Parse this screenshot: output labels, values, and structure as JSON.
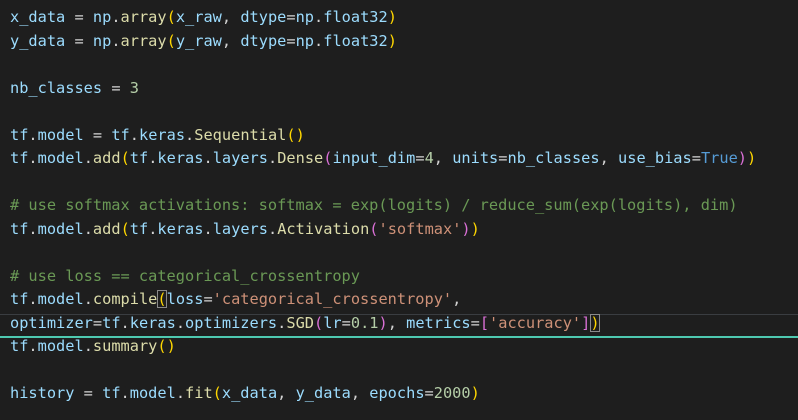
{
  "editor": {
    "theme_colors": {
      "background": "#1e1e1e",
      "variable": "#9cdcfe",
      "function": "#dcdcaa",
      "number": "#b5cea8",
      "string": "#ce9178",
      "comment": "#6a9955",
      "keyword": "#569cd6",
      "bracket_1": "#ffd700",
      "bracket_2": "#da70d6",
      "bracket_3": "#179fff",
      "active_line_underline": "#4ec9b0"
    },
    "lines": [
      {
        "tokens": [
          {
            "t": "x_data",
            "c": "t-var"
          },
          {
            "t": " = ",
            "c": "t-op"
          },
          {
            "t": "np",
            "c": "t-var"
          },
          {
            "t": ".",
            "c": "t-op"
          },
          {
            "t": "array",
            "c": "t-fn"
          },
          {
            "t": "(",
            "c": "t-b1"
          },
          {
            "t": "x_raw",
            "c": "t-var"
          },
          {
            "t": ", ",
            "c": "t-op"
          },
          {
            "t": "dtype",
            "c": "t-var"
          },
          {
            "t": "=",
            "c": "t-op"
          },
          {
            "t": "np",
            "c": "t-var"
          },
          {
            "t": ".",
            "c": "t-op"
          },
          {
            "t": "float32",
            "c": "t-var"
          },
          {
            "t": ")",
            "c": "t-b1"
          }
        ]
      },
      {
        "tokens": [
          {
            "t": "y_data",
            "c": "t-var"
          },
          {
            "t": " = ",
            "c": "t-op"
          },
          {
            "t": "np",
            "c": "t-var"
          },
          {
            "t": ".",
            "c": "t-op"
          },
          {
            "t": "array",
            "c": "t-fn"
          },
          {
            "t": "(",
            "c": "t-b1"
          },
          {
            "t": "y_raw",
            "c": "t-var"
          },
          {
            "t": ", ",
            "c": "t-op"
          },
          {
            "t": "dtype",
            "c": "t-var"
          },
          {
            "t": "=",
            "c": "t-op"
          },
          {
            "t": "np",
            "c": "t-var"
          },
          {
            "t": ".",
            "c": "t-op"
          },
          {
            "t": "float32",
            "c": "t-var"
          },
          {
            "t": ")",
            "c": "t-b1"
          }
        ]
      },
      {
        "tokens": []
      },
      {
        "tokens": [
          {
            "t": "nb_classes",
            "c": "t-var"
          },
          {
            "t": " = ",
            "c": "t-op"
          },
          {
            "t": "3",
            "c": "t-num"
          }
        ]
      },
      {
        "tokens": []
      },
      {
        "tokens": [
          {
            "t": "tf",
            "c": "t-var"
          },
          {
            "t": ".",
            "c": "t-op"
          },
          {
            "t": "model",
            "c": "t-var"
          },
          {
            "t": " = ",
            "c": "t-op"
          },
          {
            "t": "tf",
            "c": "t-var"
          },
          {
            "t": ".",
            "c": "t-op"
          },
          {
            "t": "keras",
            "c": "t-var"
          },
          {
            "t": ".",
            "c": "t-op"
          },
          {
            "t": "Sequential",
            "c": "t-fn"
          },
          {
            "t": "()",
            "c": "t-b1"
          }
        ]
      },
      {
        "tokens": [
          {
            "t": "tf",
            "c": "t-var"
          },
          {
            "t": ".",
            "c": "t-op"
          },
          {
            "t": "model",
            "c": "t-var"
          },
          {
            "t": ".",
            "c": "t-op"
          },
          {
            "t": "add",
            "c": "t-fn"
          },
          {
            "t": "(",
            "c": "t-b1"
          },
          {
            "t": "tf",
            "c": "t-var"
          },
          {
            "t": ".",
            "c": "t-op"
          },
          {
            "t": "keras",
            "c": "t-var"
          },
          {
            "t": ".",
            "c": "t-op"
          },
          {
            "t": "layers",
            "c": "t-var"
          },
          {
            "t": ".",
            "c": "t-op"
          },
          {
            "t": "Dense",
            "c": "t-fn"
          },
          {
            "t": "(",
            "c": "t-b2"
          },
          {
            "t": "input_dim",
            "c": "t-var"
          },
          {
            "t": "=",
            "c": "t-op"
          },
          {
            "t": "4",
            "c": "t-num"
          },
          {
            "t": ", ",
            "c": "t-op"
          },
          {
            "t": "units",
            "c": "t-var"
          },
          {
            "t": "=",
            "c": "t-op"
          },
          {
            "t": "nb_classes",
            "c": "t-var"
          },
          {
            "t": ", ",
            "c": "t-op"
          },
          {
            "t": "use_bias",
            "c": "t-var"
          },
          {
            "t": "=",
            "c": "t-op"
          },
          {
            "t": "True",
            "c": "t-kw"
          },
          {
            "t": ")",
            "c": "t-b2"
          },
          {
            "t": ")",
            "c": "t-b1"
          }
        ]
      },
      {
        "tokens": []
      },
      {
        "tokens": [
          {
            "t": "# use softmax activations: softmax = exp(logits) / reduce_sum(exp(logits), dim)",
            "c": "t-cmt"
          }
        ]
      },
      {
        "tokens": [
          {
            "t": "tf",
            "c": "t-var"
          },
          {
            "t": ".",
            "c": "t-op"
          },
          {
            "t": "model",
            "c": "t-var"
          },
          {
            "t": ".",
            "c": "t-op"
          },
          {
            "t": "add",
            "c": "t-fn"
          },
          {
            "t": "(",
            "c": "t-b1"
          },
          {
            "t": "tf",
            "c": "t-var"
          },
          {
            "t": ".",
            "c": "t-op"
          },
          {
            "t": "keras",
            "c": "t-var"
          },
          {
            "t": ".",
            "c": "t-op"
          },
          {
            "t": "layers",
            "c": "t-var"
          },
          {
            "t": ".",
            "c": "t-op"
          },
          {
            "t": "Activation",
            "c": "t-fn"
          },
          {
            "t": "(",
            "c": "t-b2"
          },
          {
            "t": "'softmax'",
            "c": "t-str"
          },
          {
            "t": ")",
            "c": "t-b2"
          },
          {
            "t": ")",
            "c": "t-b1"
          }
        ]
      },
      {
        "tokens": []
      },
      {
        "tokens": [
          {
            "t": "# use loss == categorical_crossentropy",
            "c": "t-cmt"
          }
        ]
      },
      {
        "tokens": [
          {
            "t": "tf",
            "c": "t-var"
          },
          {
            "t": ".",
            "c": "t-op"
          },
          {
            "t": "model",
            "c": "t-var"
          },
          {
            "t": ".",
            "c": "t-op"
          },
          {
            "t": "compile",
            "c": "t-fn"
          },
          {
            "t": "(",
            "c": "t-b1 bracket-box"
          },
          {
            "t": "loss",
            "c": "t-var"
          },
          {
            "t": "=",
            "c": "t-op"
          },
          {
            "t": "'categorical_crossentropy'",
            "c": "t-str"
          },
          {
            "t": ",",
            "c": "t-op"
          }
        ]
      },
      {
        "active": true,
        "tokens": [
          {
            "t": "optimizer",
            "c": "t-var"
          },
          {
            "t": "=",
            "c": "t-op"
          },
          {
            "t": "tf",
            "c": "t-var"
          },
          {
            "t": ".",
            "c": "t-op"
          },
          {
            "t": "keras",
            "c": "t-var"
          },
          {
            "t": ".",
            "c": "t-op"
          },
          {
            "t": "optimizers",
            "c": "t-var"
          },
          {
            "t": ".",
            "c": "t-op"
          },
          {
            "t": "SGD",
            "c": "t-fn"
          },
          {
            "t": "(",
            "c": "t-b2"
          },
          {
            "t": "lr",
            "c": "t-var"
          },
          {
            "t": "=",
            "c": "t-op"
          },
          {
            "t": "0.1",
            "c": "t-num"
          },
          {
            "t": ")",
            "c": "t-b2"
          },
          {
            "t": ", ",
            "c": "t-op"
          },
          {
            "t": "metrics",
            "c": "t-var"
          },
          {
            "t": "=",
            "c": "t-op"
          },
          {
            "t": "[",
            "c": "t-b2"
          },
          {
            "t": "'accuracy'",
            "c": "t-str"
          },
          {
            "t": "]",
            "c": "t-b2"
          },
          {
            "t": ")",
            "c": "t-b1 bracket-box"
          }
        ]
      },
      {
        "tokens": [
          {
            "t": "tf",
            "c": "t-var"
          },
          {
            "t": ".",
            "c": "t-op"
          },
          {
            "t": "model",
            "c": "t-var"
          },
          {
            "t": ".",
            "c": "t-op"
          },
          {
            "t": "summary",
            "c": "t-fn"
          },
          {
            "t": "()",
            "c": "t-b1"
          }
        ]
      },
      {
        "tokens": []
      },
      {
        "tokens": [
          {
            "t": "history",
            "c": "t-var"
          },
          {
            "t": " = ",
            "c": "t-op"
          },
          {
            "t": "tf",
            "c": "t-var"
          },
          {
            "t": ".",
            "c": "t-op"
          },
          {
            "t": "model",
            "c": "t-var"
          },
          {
            "t": ".",
            "c": "t-op"
          },
          {
            "t": "fit",
            "c": "t-fn"
          },
          {
            "t": "(",
            "c": "t-b1"
          },
          {
            "t": "x_data",
            "c": "t-var"
          },
          {
            "t": ", ",
            "c": "t-op"
          },
          {
            "t": "y_data",
            "c": "t-var"
          },
          {
            "t": ", ",
            "c": "t-op"
          },
          {
            "t": "epochs",
            "c": "t-var"
          },
          {
            "t": "=",
            "c": "t-op"
          },
          {
            "t": "2000",
            "c": "t-num"
          },
          {
            "t": ")",
            "c": "t-b1"
          }
        ]
      }
    ]
  }
}
